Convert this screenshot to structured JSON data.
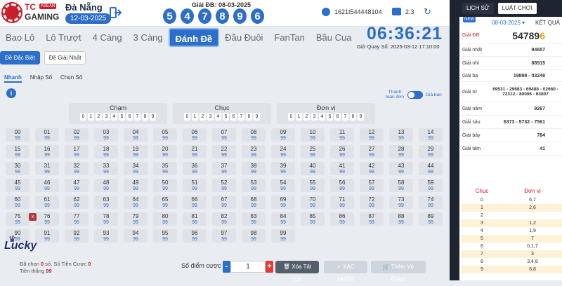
{
  "header": {
    "logo_tc": "TC",
    "logo_asean": "ASEAN",
    "logo_gaming": "GAMING",
    "city": "Đà Nẵng",
    "date": "12-03-2025",
    "gdb_label": "Giải ĐB: 08-03-2025",
    "gdb_digits": [
      "5",
      "4",
      "7",
      "8",
      "9",
      "6"
    ],
    "username": "1621t544448104",
    "balance": "2.3"
  },
  "tabs": [
    "Bao Lô",
    "Lô Trượt",
    "4 Càng",
    "3 Càng",
    "Đánh Đề",
    "Đầu Đuôi",
    "FanTan",
    "Bầu Cua"
  ],
  "active_tab": "Đánh Đề",
  "clock": "06:36:21",
  "draw_time": "Giờ Quay Số: 2025-03-12 17:10:00",
  "subtabs": [
    "Đề Đặc Biệt",
    "Đề Giải Nhất"
  ],
  "modes": [
    "Nhanh",
    "Nhập Số",
    "Chọn Số"
  ],
  "toggle": {
    "left": "Thanh toán đơn",
    "right": "Giá bán"
  },
  "groups": [
    {
      "title": "Chạm",
      "nums": [
        "0",
        "1",
        "2",
        "3",
        "4",
        "5",
        "6",
        "7",
        "8",
        "9"
      ]
    },
    {
      "title": "Chục",
      "nums": [
        "0",
        "1",
        "2",
        "3",
        "4",
        "5",
        "6",
        "7",
        "8",
        "9"
      ]
    },
    {
      "title": "Đơn vị",
      "nums": [
        "0",
        "1",
        "2",
        "3",
        "4",
        "5",
        "6",
        "7",
        "8",
        "9"
      ]
    }
  ],
  "odds": "99",
  "numbers_rows": [
    [
      "00",
      "01",
      "02",
      "03",
      "04",
      "05",
      "06",
      "07",
      "08",
      "09",
      "10",
      "11",
      "12",
      "13",
      "14"
    ],
    [
      "15",
      "16",
      "17",
      "18",
      "19",
      "20",
      "21",
      "22",
      "23",
      "24",
      "25",
      "26",
      "27",
      "28",
      "29"
    ],
    [
      "30",
      "31",
      "32",
      "33",
      "34",
      "35",
      "36",
      "37",
      "38",
      "39",
      "40",
      "41",
      "42",
      "43",
      "44"
    ],
    [
      "45",
      "46",
      "47",
      "48",
      "49",
      "50",
      "51",
      "52",
      "53",
      "54",
      "55",
      "56",
      "57",
      "58",
      "59"
    ],
    [
      "60",
      "61",
      "62",
      "63",
      "64",
      "65",
      "66",
      "67",
      "68",
      "69",
      "70",
      "71",
      "72",
      "73",
      "74"
    ],
    [
      "75",
      "76",
      "77",
      "78",
      "79",
      "80",
      "81",
      "82",
      "83",
      "84",
      "85",
      "86",
      "87",
      "88",
      "89"
    ],
    [
      "90",
      "91",
      "92",
      "93",
      "94",
      "95",
      "96",
      "97",
      "98",
      "99",
      "",
      "",
      "",
      "",
      ""
    ]
  ],
  "summary": {
    "chosen_label": "Đã chọn",
    "chosen": "0",
    "chosen_unit": "số,",
    "bet_label": "Số Tiền Cược",
    "bet": "0",
    "win_label": "Tiền thắng",
    "win": "99"
  },
  "stake": {
    "label": "Số điểm cược",
    "value": "1",
    "minus": "-",
    "plus": "+"
  },
  "buttons": {
    "clear": "Xóa Tất Cả",
    "confirm": "XÁC NHẬN",
    "cart": "Thêm Vé Cược"
  },
  "panel": {
    "tab_history": "LỊCH SỬ",
    "tab_rules": "LUẬT CHƠI",
    "new_tag": "NEW",
    "date": "08-03-2025",
    "result_label": "KẾT QUẢ",
    "prizes": [
      {
        "label": "Giải ĐB",
        "value_main": "54789",
        "value_hl": "6",
        "special": true
      },
      {
        "label": "Giải nhất",
        "value": "94657"
      },
      {
        "label": "Giải nhì",
        "value": "88915"
      },
      {
        "label": "Giải ba",
        "value": "19898 - 03249"
      },
      {
        "label": "Giải tư",
        "value": "69531 - 29683 - 69488 - 02660 - 72312 - 80006 - 63807"
      },
      {
        "label": "Giải năm",
        "value": "9267"
      },
      {
        "label": "Giải sáu",
        "value": "6373 - 5732 - 7561"
      },
      {
        "label": "Giải bảy",
        "value": "784"
      },
      {
        "label": "Giải tám",
        "value": "41"
      }
    ],
    "chuc_head": "Chục",
    "donvi_head": "Đơn vị",
    "chuc_rows": [
      {
        "a": "0",
        "b": "6,7"
      },
      {
        "a": "1",
        "b": "2,6"
      },
      {
        "a": "2",
        "b": ""
      },
      {
        "a": "3",
        "b": "1,2"
      },
      {
        "a": "4",
        "b": "1,9"
      },
      {
        "a": "5",
        "b": "7"
      },
      {
        "a": "6",
        "b": "0,1,7"
      },
      {
        "a": "7",
        "b": "3"
      },
      {
        "a": "8",
        "b": "3,4,8"
      },
      {
        "a": "9",
        "b": "6,8"
      }
    ]
  },
  "colors": {
    "accent": "#2d6ec9",
    "red": "#c8202a",
    "highlight": "#e89a1b",
    "dark": "#1e2430"
  },
  "icons": [
    "exit-icon",
    "user-icon",
    "wallet-icon",
    "refresh-icon",
    "info-icon",
    "trash-icon",
    "cart-icon"
  ]
}
